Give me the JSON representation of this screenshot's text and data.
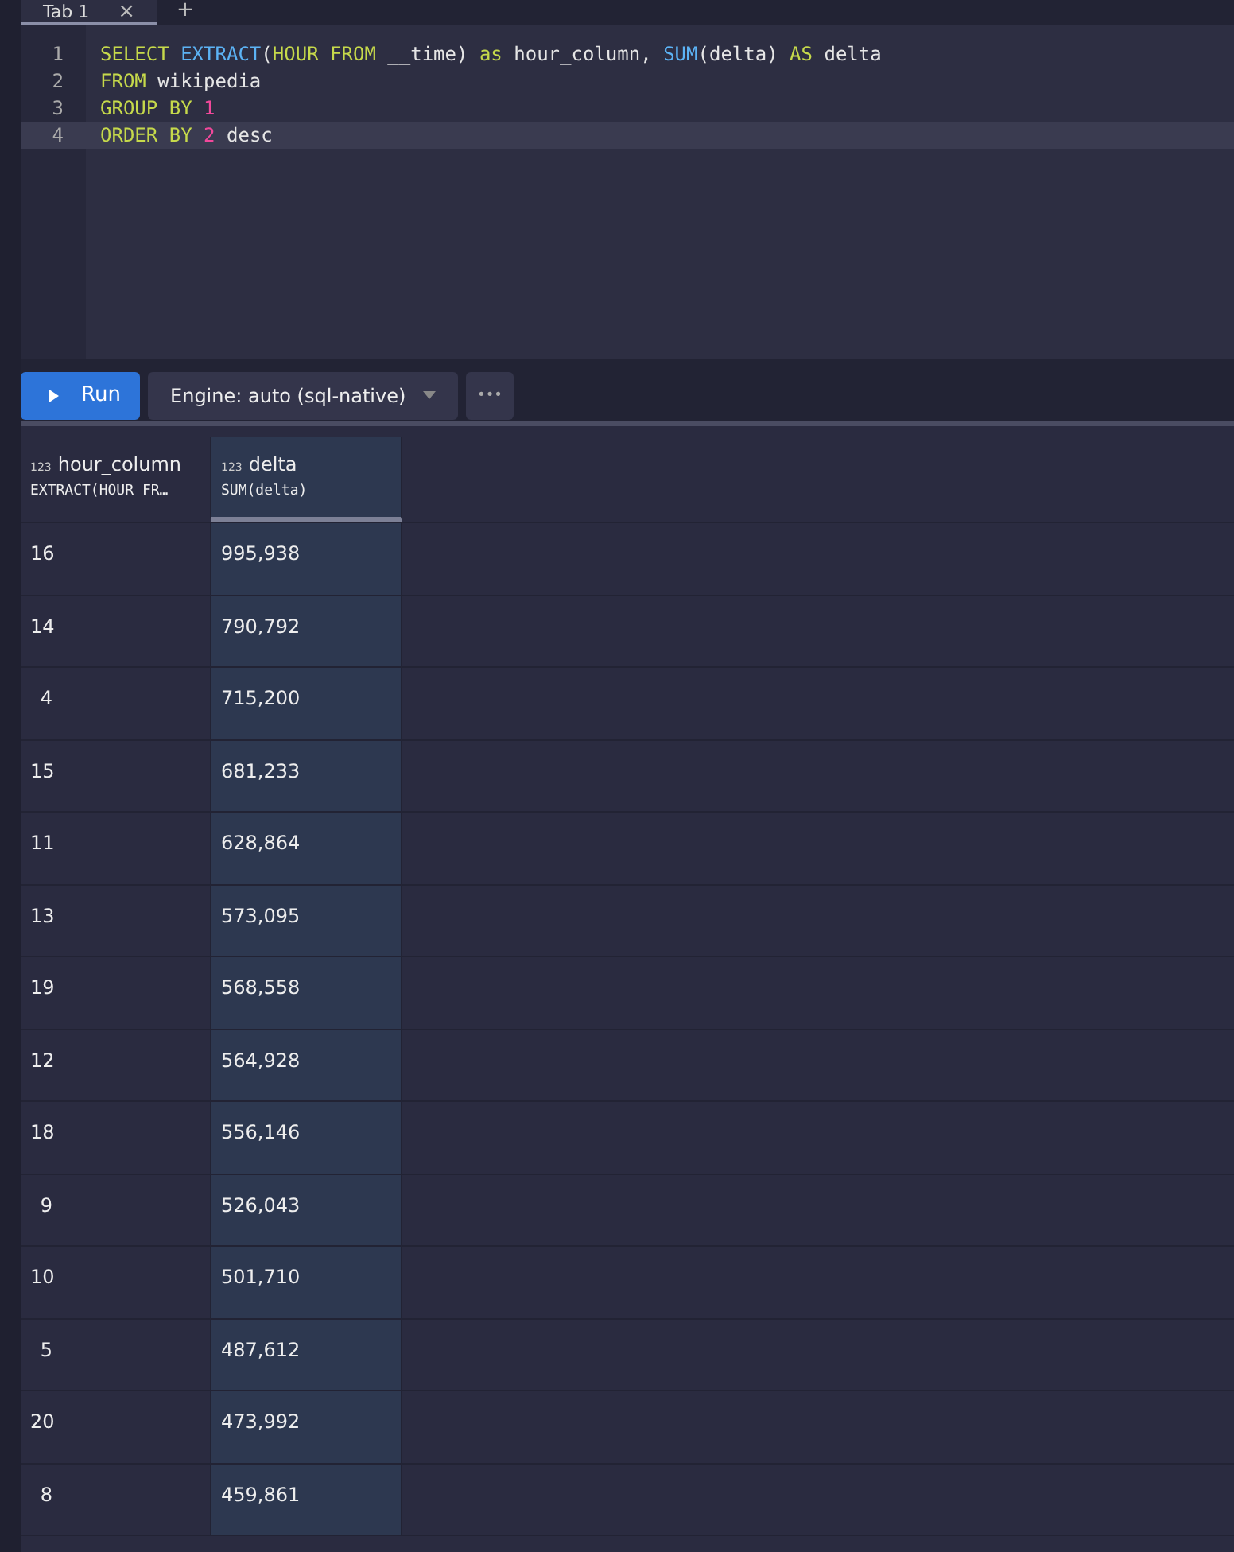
{
  "tabs": [
    {
      "label": "Tab 1",
      "selected": true,
      "close": "×"
    }
  ],
  "new_tab": "+",
  "editor": {
    "lines": [
      {
        "number": "1",
        "highlighted": false,
        "tokens": [
          {
            "kind": "keyword",
            "text": "SELECT "
          },
          {
            "kind": "function",
            "text": "EXTRACT"
          },
          {
            "kind": "plain",
            "text": "("
          },
          {
            "kind": "keyword",
            "text": "HOUR FROM"
          },
          {
            "kind": "plain",
            "text": " __time) "
          },
          {
            "kind": "keyword",
            "text": "as"
          },
          {
            "kind": "plain",
            "text": " hour_column, "
          },
          {
            "kind": "function",
            "text": "SUM"
          },
          {
            "kind": "plain",
            "text": "(delta) "
          },
          {
            "kind": "keyword",
            "text": "AS"
          },
          {
            "kind": "plain",
            "text": " delta"
          }
        ]
      },
      {
        "number": "2",
        "highlighted": false,
        "tokens": [
          {
            "kind": "keyword",
            "text": "FROM"
          },
          {
            "kind": "plain",
            "text": " wikipedia"
          }
        ]
      },
      {
        "number": "3",
        "highlighted": false,
        "tokens": [
          {
            "kind": "keyword",
            "text": "GROUP BY "
          },
          {
            "kind": "number",
            "text": "1"
          }
        ]
      },
      {
        "number": "4",
        "highlighted": true,
        "tokens": [
          {
            "kind": "keyword",
            "text": "ORDER BY "
          },
          {
            "kind": "number",
            "text": "2"
          },
          {
            "kind": "plain",
            "text": " desc"
          }
        ]
      }
    ]
  },
  "toolbar": {
    "run": "Run",
    "engine": "Engine: auto (sql-native)",
    "more": "•••"
  },
  "table": {
    "columns": [
      {
        "type_badge": "123",
        "name": "hour_column",
        "expression": "EXTRACT(HOUR FR…",
        "selected": false
      },
      {
        "type_badge": "123",
        "name": "delta",
        "expression": "SUM(delta)",
        "selected": true
      }
    ],
    "rows": [
      [
        "16",
        "995,938"
      ],
      [
        "14",
        "790,792"
      ],
      [
        "4",
        "715,200"
      ],
      [
        "15",
        "681,233"
      ],
      [
        "11",
        "628,864"
      ],
      [
        "13",
        "573,095"
      ],
      [
        "19",
        "568,558"
      ],
      [
        "12",
        "564,928"
      ],
      [
        "18",
        "556,146"
      ],
      [
        "9",
        "526,043"
      ],
      [
        "10",
        "501,710"
      ],
      [
        "5",
        "487,612"
      ],
      [
        "20",
        "473,992"
      ],
      [
        "8",
        "459,861"
      ]
    ]
  }
}
